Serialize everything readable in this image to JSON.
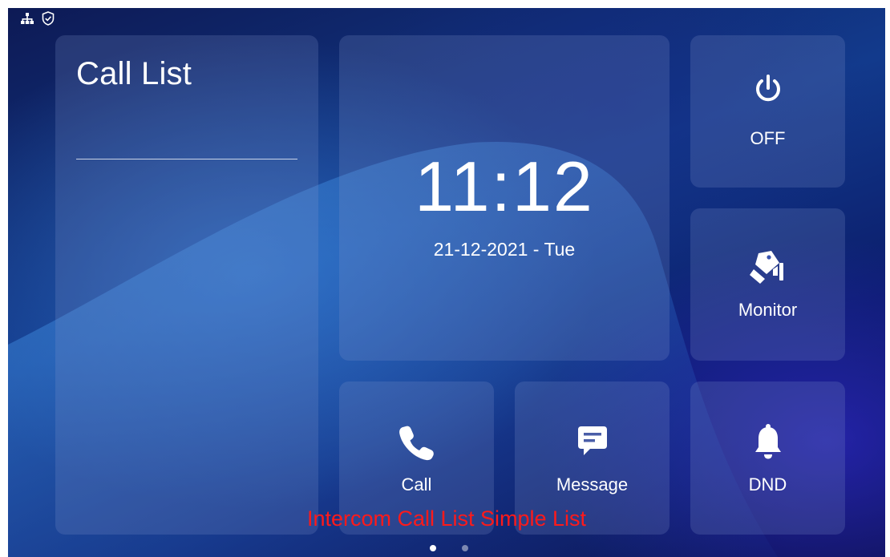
{
  "status_bar": {
    "icons": [
      "network-icon",
      "shield-check-icon"
    ]
  },
  "call_list": {
    "title": "Call List"
  },
  "clock": {
    "time": "11:12",
    "date": "21-12-2021 - Tue"
  },
  "buttons": {
    "off": {
      "label": "OFF",
      "icon": "power-icon"
    },
    "monitor": {
      "label": "Monitor",
      "icon": "cctv-camera-icon"
    },
    "call": {
      "label": "Call",
      "icon": "phone-icon"
    },
    "message": {
      "label": "Message",
      "icon": "message-icon"
    },
    "dnd": {
      "label": "DND",
      "icon": "bell-icon"
    }
  },
  "caption": "Intercom Call List Simple List",
  "pager": {
    "pages": 2,
    "active_page": 1
  },
  "colors": {
    "caption": "#ff1a1a",
    "tile": "rgba(130,150,205,0.22)",
    "background": "#123a8c"
  }
}
